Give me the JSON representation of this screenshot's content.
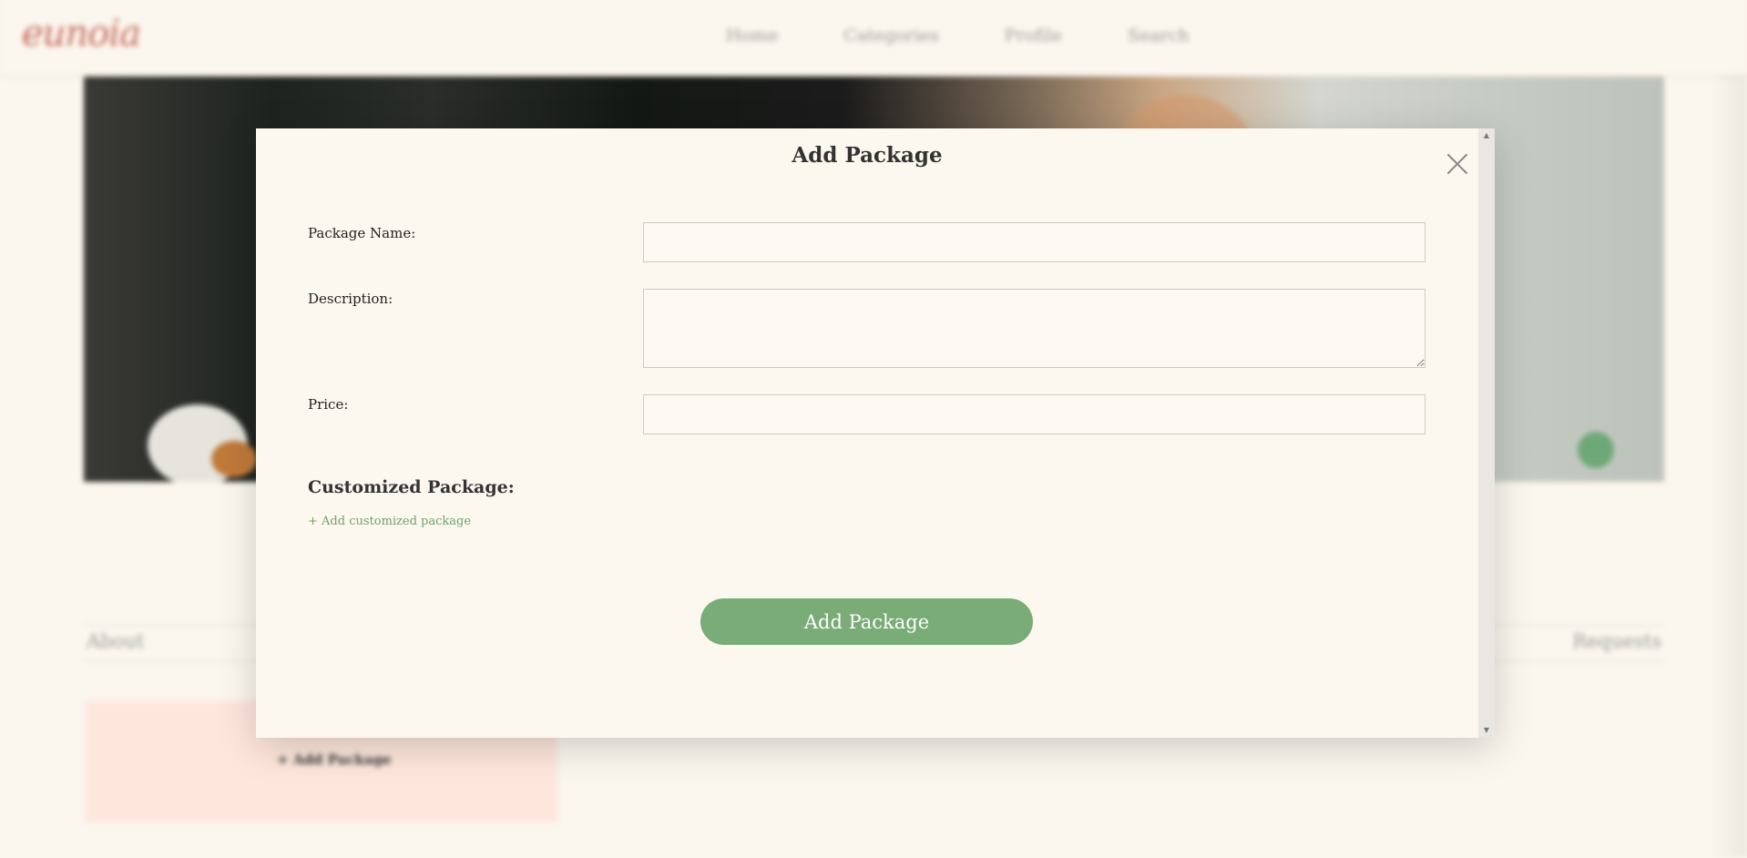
{
  "header": {
    "logo": "eunoia",
    "nav": [
      "Home",
      "Categories",
      "Profile",
      "Search"
    ]
  },
  "profile": {
    "tab_about": "About",
    "tab_requests": "Requests",
    "add_package_card": "+ Add Package"
  },
  "modal": {
    "title": "Add Package",
    "package_name_label": "Package Name:",
    "package_name_value": "",
    "description_label": "Description:",
    "description_value": "",
    "price_label": "Price:",
    "price_value": "",
    "customized_title": "Customized Package:",
    "add_customized_link": "+ Add customized package",
    "submit_label": "Add Package"
  },
  "colors": {
    "accent_green": "#79ac76",
    "logo_color": "#c46a5a",
    "card_pink": "#fde6dc"
  }
}
